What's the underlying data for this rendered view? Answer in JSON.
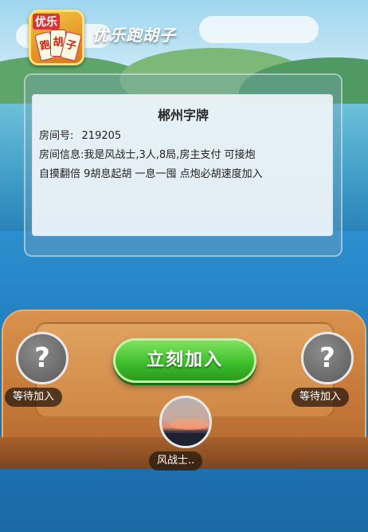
{
  "app": {
    "logo_top": "优乐",
    "logo_cards": [
      "跑",
      "胡",
      "子"
    ],
    "brand": "优乐跑胡子"
  },
  "room": {
    "title": "郴州字牌",
    "number_label": "房间号:",
    "number": "219205",
    "info_line1": "房间信息:我是风战士,3人,8局,房主支付 可接炮",
    "info_line2": "自摸翻倍 9胡息起胡 一息一囤 点炮必胡速度加入"
  },
  "actions": {
    "join_label": "立刻加入"
  },
  "seats": {
    "left": {
      "avatar": "?",
      "status": "等待加入"
    },
    "right": {
      "avatar": "?",
      "status": "等待加入"
    },
    "host": {
      "name": "风战士.."
    }
  },
  "colors": {
    "join_button": "#3fbf2e",
    "table": "#c67a39",
    "background": "#1d6fa8"
  }
}
